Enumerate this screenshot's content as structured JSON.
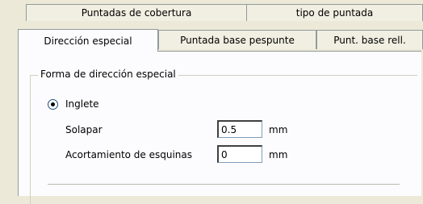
{
  "tabs_row1": [
    {
      "label": "Puntadas de cobertura"
    },
    {
      "label": "tipo de puntada"
    }
  ],
  "tabs_row2": [
    {
      "label": "Dirección especial",
      "active": true
    },
    {
      "label": "Puntada base pespunte",
      "active": false
    },
    {
      "label": "Punt. base rell.",
      "active": false
    }
  ],
  "group": {
    "title": "Forma de dirección especial",
    "radio": {
      "label": "Inglete",
      "checked": true
    },
    "solapar": {
      "label": "Solapar",
      "value": "0.5",
      "unit": "mm"
    },
    "acortamiento": {
      "label": "Acortamiento de esquinas",
      "value": "0",
      "unit": "mm"
    }
  }
}
